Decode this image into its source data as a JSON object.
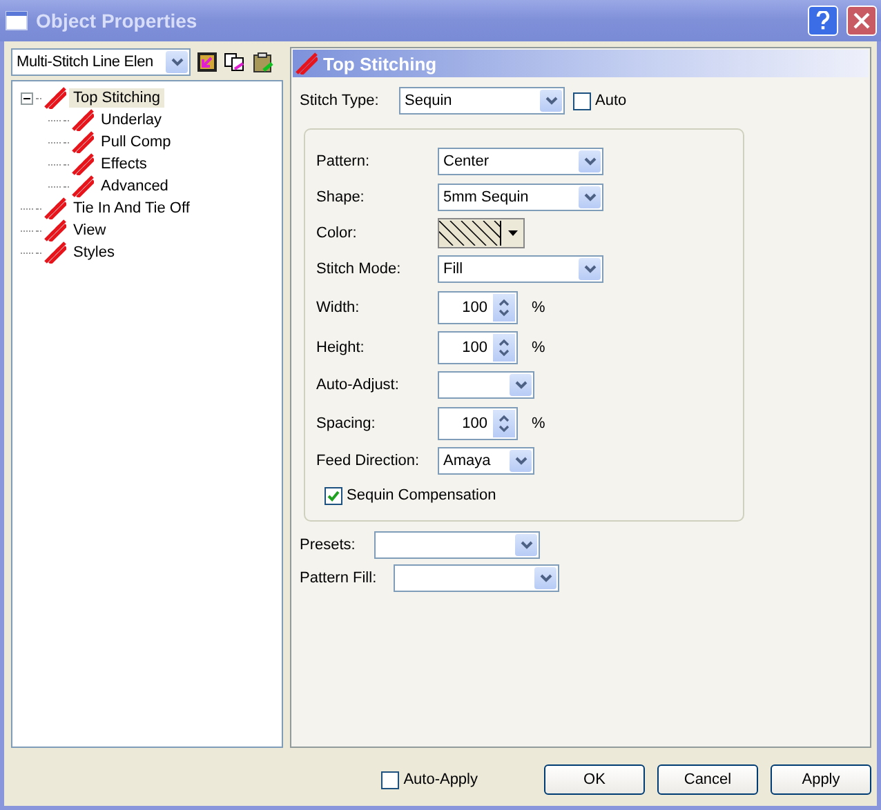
{
  "window": {
    "title": "Object Properties"
  },
  "element_combo": {
    "value": "Multi-Stitch Line Elen"
  },
  "tree": [
    {
      "label": "Top Stitching",
      "selected": true,
      "expanded": true,
      "children": [
        {
          "label": "Underlay",
          "selected": false
        },
        {
          "label": "Pull Comp",
          "selected": false
        },
        {
          "label": "Effects",
          "selected": false
        },
        {
          "label": "Advanced",
          "selected": false
        }
      ]
    },
    {
      "label": "Tie In And Tie Off",
      "selected": false
    },
    {
      "label": "View",
      "selected": false
    },
    {
      "label": "Styles",
      "selected": false
    }
  ],
  "panel": {
    "title": "Top Stitching",
    "stitch_type": {
      "label": "Stitch Type:",
      "value": "Sequin"
    },
    "auto": {
      "label": "Auto",
      "checked": false
    },
    "fields": [
      {
        "kind": "select",
        "label": "Pattern:",
        "value": "Center"
      },
      {
        "kind": "select",
        "label": "Shape:",
        "value": "5mm Sequin"
      },
      {
        "kind": "color",
        "label": "Color:"
      },
      {
        "kind": "select",
        "label": "Stitch Mode:",
        "value": "Fill"
      },
      {
        "kind": "spin",
        "label": "Width:",
        "value": "100",
        "unit": "%"
      },
      {
        "kind": "spin",
        "label": "Height:",
        "value": "100",
        "unit": "%"
      },
      {
        "kind": "short-select",
        "label": "Auto-Adjust:"
      },
      {
        "kind": "spin",
        "label": "Spacing:",
        "value": "100",
        "unit": "%"
      },
      {
        "kind": "short-select",
        "label": "Feed Direction:",
        "value": "Amaya"
      }
    ],
    "sequin_compensation": {
      "label": "Sequin Compensation",
      "checked": true
    },
    "presets": {
      "label": "Presets:"
    },
    "pattern_fill": {
      "label": "Pattern Fill:"
    }
  },
  "footer": {
    "auto_apply": {
      "label": "Auto-Apply",
      "checked": false
    },
    "buttons": [
      "OK",
      "Cancel",
      "Apply"
    ]
  }
}
